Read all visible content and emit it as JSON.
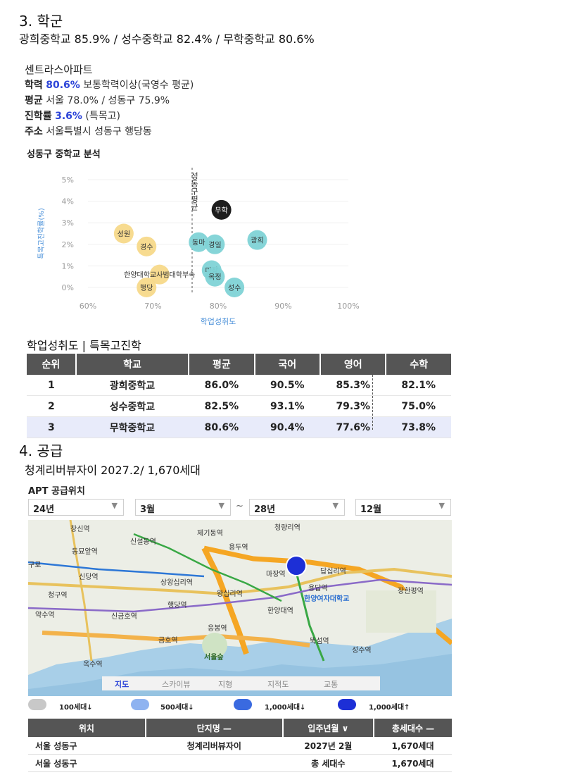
{
  "section3": {
    "heading": "3. 학군",
    "summary": "광희중학교 85.9% / 성수중학교 82.4% / 무학중학교 80.6%"
  },
  "apartment": {
    "name": "센트라스아파트",
    "academic_label": "학력",
    "academic_value": "80.6%",
    "academic_desc": "보통학력이상(국영수 평균)",
    "average_label": "평균",
    "average_value": "서울 78.0% / 성동구 75.9%",
    "advance_label": "진학률",
    "advance_value": "3.6%",
    "advance_desc": "(특목고)",
    "address_label": "주소",
    "address_value": "서울특별시 성동구 행당동"
  },
  "chart_title": "성동구 중학교 분석",
  "chart_data": {
    "type": "scatter",
    "xlabel": "학업성취도",
    "ylabel": "특목고진학률(%)",
    "xlim": [
      60,
      100
    ],
    "ylim": [
      0,
      5
    ],
    "x_ticks": [
      "60%",
      "70%",
      "80%",
      "90%",
      "100%"
    ],
    "y_ticks": [
      "5%",
      "4%",
      "3%",
      "2%",
      "1%",
      "0%"
    ],
    "reference_line_x": 76,
    "reference_label": "성동구평균",
    "points": [
      {
        "label": "성원",
        "x": 65.5,
        "y": 2.5,
        "color": "#f7d98a"
      },
      {
        "label": "경수",
        "x": 69,
        "y": 1.9,
        "color": "#f7d98a"
      },
      {
        "label": "한양대학교사범대학부속",
        "x": 71,
        "y": 0.6,
        "color": "#f7d98a"
      },
      {
        "label": "행당",
        "x": 69,
        "y": 0,
        "color": "#f7d98a"
      },
      {
        "label": "동마",
        "x": 77,
        "y": 2.1,
        "color": "#7fd3d6"
      },
      {
        "label": "경일",
        "x": 79.5,
        "y": 2.0,
        "color": "#7fd3d6"
      },
      {
        "label": "광희",
        "x": 86,
        "y": 2.2,
        "color": "#7fd3d6"
      },
      {
        "label": "마장",
        "x": 79,
        "y": 0.8,
        "color": "#7fd3d6"
      },
      {
        "label": "옥정",
        "x": 79.5,
        "y": 0.5,
        "color": "#7fd3d6"
      },
      {
        "label": "성수",
        "x": 82.5,
        "y": 0,
        "color": "#7fd3d6"
      },
      {
        "label": "무학",
        "x": 80.5,
        "y": 3.6,
        "color": "#111111"
      }
    ]
  },
  "table_title": "학업성취도 | 특목고진학",
  "ranking": {
    "headers": [
      "순위",
      "학교",
      "평균",
      "국어",
      "영어",
      "수학"
    ],
    "rows": [
      [
        "1",
        "광희중학교",
        "86.0%",
        "90.5%",
        "85.3%",
        "82.1%"
      ],
      [
        "2",
        "성수중학교",
        "82.5%",
        "93.1%",
        "79.3%",
        "75.0%"
      ],
      [
        "3",
        "무학중학교",
        "80.6%",
        "90.4%",
        "77.6%",
        "73.8%"
      ]
    ]
  },
  "section4": {
    "heading": "4. 공급",
    "summary": "청계리버뷰자이 2027.2/ 1,670세대"
  },
  "supply_map": {
    "title": "APT 공급위치",
    "filters": [
      "24년",
      "3월",
      "28년",
      "12월"
    ],
    "separator": "~",
    "map_tabs": [
      "지도",
      "스카이뷰",
      "지형",
      "지적도",
      "교통"
    ],
    "places": [
      "신당역",
      "청구역",
      "약수역",
      "동묘앞역",
      "상왕십리역",
      "왕십리역",
      "행당역",
      "마장역",
      "용답역",
      "한양대역",
      "응봉역",
      "옥수역",
      "금호역",
      "신금호역",
      "서울숲",
      "뚝섬역",
      "성수역",
      "한양여자대학교",
      "답십리역",
      "장한평역",
      "제기동역",
      "청량리역",
      "창신역",
      "신설동역",
      "용두역",
      "동대문구청",
      "구로"
    ],
    "legend": [
      "100세대↓",
      "500세대↓",
      "1,000세대↓",
      "1,000세대↑"
    ],
    "legend_colors": [
      "#c8c8c8",
      "#8fb3f0",
      "#3a6ae0",
      "#1d2fd6"
    ]
  },
  "supply_table": {
    "headers": [
      "위치",
      "단지명 —",
      "입주년월 ∨",
      "총세대수 —"
    ],
    "rows": [
      [
        "서울 성동구",
        "청계리버뷰자이",
        "2027년 2월",
        "1,670세대"
      ],
      [
        "서울 성동구",
        "",
        "총 세대수",
        "1,670세대"
      ]
    ]
  }
}
